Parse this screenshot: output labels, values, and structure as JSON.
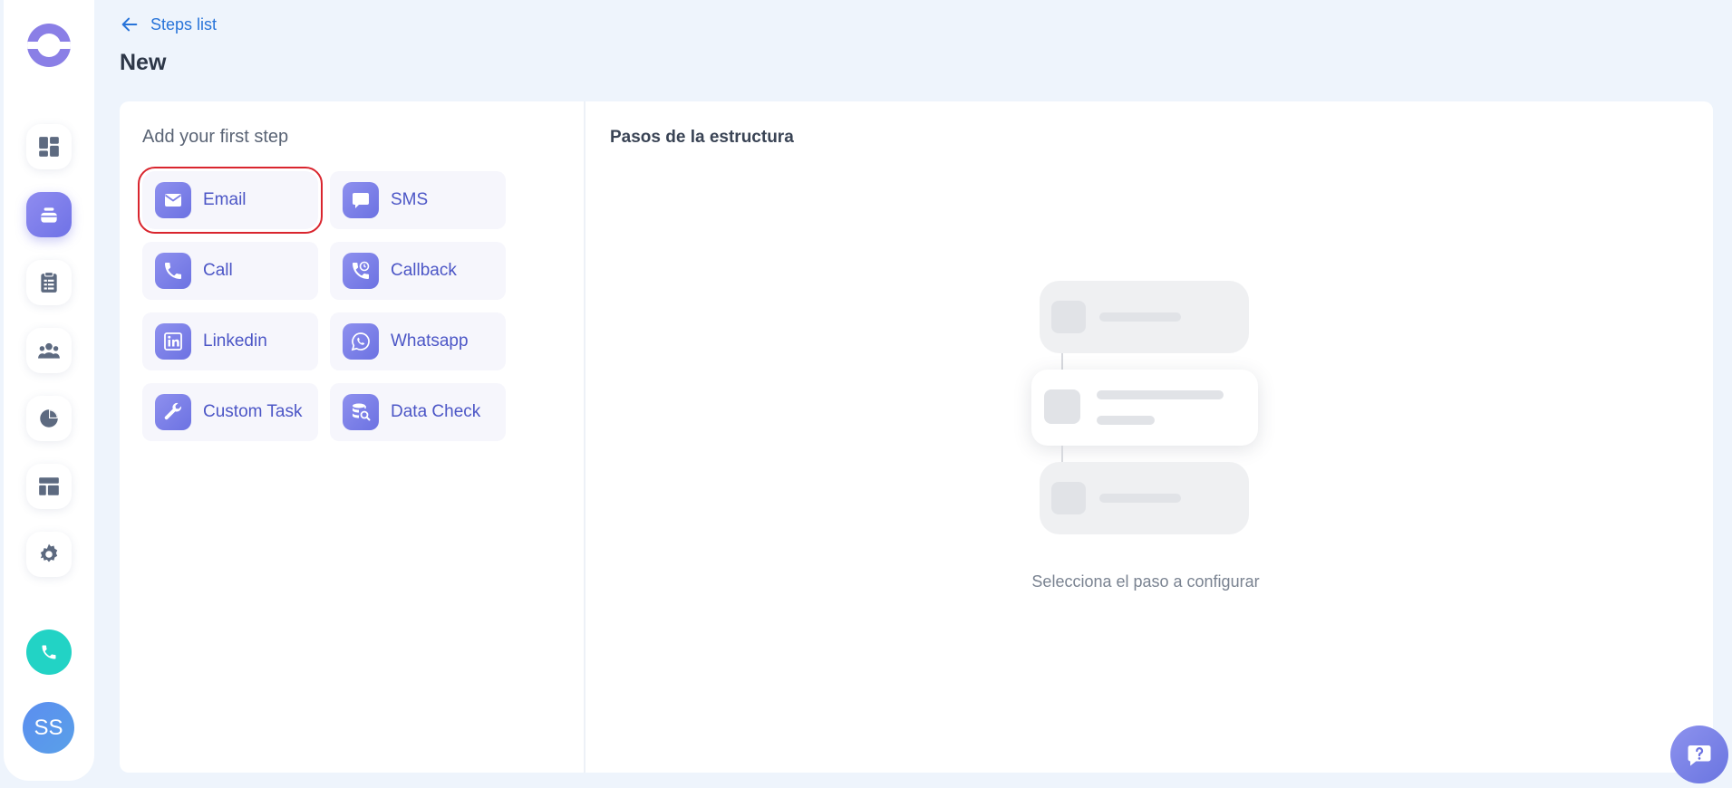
{
  "header": {
    "back_label": "Steps list",
    "title": "New"
  },
  "sidebar": {
    "items": [
      {
        "icon": "dashboard-icon"
      },
      {
        "icon": "sequences-icon",
        "active": true
      },
      {
        "icon": "tasks-icon"
      },
      {
        "icon": "contacts-icon"
      },
      {
        "icon": "reports-icon"
      },
      {
        "icon": "templates-icon"
      },
      {
        "icon": "gear-icon"
      }
    ],
    "phone_icon": "phone-icon",
    "avatar_initials": "SS"
  },
  "left_panel": {
    "heading": "Add your first step",
    "steps": [
      {
        "label": "Email",
        "icon": "email-icon"
      },
      {
        "label": "SMS",
        "icon": "chat-icon"
      },
      {
        "label": "Call",
        "icon": "phone-icon"
      },
      {
        "label": "Callback",
        "icon": "callback-icon"
      },
      {
        "label": "Linkedin",
        "icon": "linkedin-icon"
      },
      {
        "label": "Whatsapp",
        "icon": "whatsapp-icon"
      },
      {
        "label": "Custom Task",
        "icon": "wrench-icon"
      },
      {
        "label": "Data Check",
        "icon": "database-search-icon"
      }
    ]
  },
  "right_panel": {
    "heading": "Pasos de la estructura",
    "empty_text": "Selecciona el paso a configurar"
  },
  "colors": {
    "accent": "#6c72e2",
    "link": "#2874d9",
    "selected_outline": "#d9252e",
    "phone_button": "#22d3c5"
  }
}
